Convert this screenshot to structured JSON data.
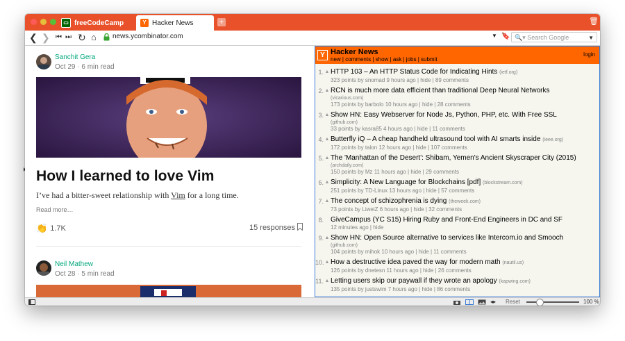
{
  "browser": {
    "tabs": [
      {
        "label": "freeCodeCamp",
        "icon": "freecodecamp-icon",
        "active": false
      },
      {
        "label": "Hacker News",
        "icon": "y-icon",
        "active": true
      }
    ],
    "url": "news.ycombinator.com",
    "search_placeholder": "Search Google",
    "tab_bar_color": "#e8512a",
    "status": {
      "reset_label": "Reset",
      "zoom_label": "100 %"
    }
  },
  "medium": {
    "posts": [
      {
        "author": "Sanchit Gera",
        "date": "Oct 29",
        "read_time": "6 min read",
        "title": "How I learned to love Vim",
        "subtitle_before": "I’ve had a bitter-sweet relationship with ",
        "subtitle_link": "Vim",
        "subtitle_after": " for a long time.",
        "read_more": "Read more…",
        "claps": "1.7K",
        "responses": "15 responses"
      },
      {
        "author": "Neil Mathew",
        "date": "Oct 28",
        "read_time": "5 min read"
      }
    ]
  },
  "hn": {
    "title": "Hacker News",
    "nav": "new | comments | show | ask | jobs | submit",
    "login": "login",
    "header_color": "#ff6600",
    "items": [
      {
        "rank": "1.",
        "title": "HTTP 103 – An HTTP Status Code for Indicating Hints",
        "site": "(ietf.org)",
        "meta": "323 points by snomad 9 hours ago | hide | 89 comments",
        "vote": true
      },
      {
        "rank": "2.",
        "title": "RCN is much more data efficient than traditional Deep Neural Networks",
        "site": "(vicarious.com)",
        "meta": "173 points by barbolo 10 hours ago | hide | 28 comments",
        "vote": true,
        "site_newline": true
      },
      {
        "rank": "3.",
        "title": "Show HN: Easy Webserver for Node Js, Python, PHP, etc. With Free SSL",
        "site": "(github.com)",
        "meta": "33 points by kasra85 4 hours ago | hide | 11 comments",
        "vote": true,
        "site_newline": true
      },
      {
        "rank": "4.",
        "title": "Butterfly iQ – A cheap handheld ultrasound tool with AI smarts inside",
        "site": "(ieee.org)",
        "meta": "172 points by taion 12 hours ago | hide | 107 comments",
        "vote": true
      },
      {
        "rank": "5.",
        "title": "The 'Manhattan of the Desert': Shibam, Yemen's Ancient Skyscraper City (2015)",
        "site": "(archdaily.com)",
        "meta": "150 points by Mz 11 hours ago | hide | 29 comments",
        "vote": true,
        "site_newline": true
      },
      {
        "rank": "6.",
        "title": "Simplicity: A New Language for Blockchains [pdf]",
        "site": "(blockstream.com)",
        "meta": "251 points by TD-Linux 13 hours ago | hide | 57 comments",
        "vote": true
      },
      {
        "rank": "7.",
        "title": "The concept of schizophrenia is dying",
        "site": "(theweek.com)",
        "meta": "73 points by LiweiZ 6 hours ago | hide | 32 comments",
        "vote": true
      },
      {
        "rank": "8.",
        "title": "GiveCampus (YC S15) Hiring Ruby and Front-End Engineers in DC and SF",
        "site": "",
        "meta": "12 minutes ago | hide",
        "vote": false
      },
      {
        "rank": "9.",
        "title": "Show HN: Open Source alternative to services like Intercom.io and Smooch",
        "site": "(github.com)",
        "meta": "104 points by mihok 10 hours ago | hide | 11 comments",
        "vote": true,
        "site_newline": true
      },
      {
        "rank": "10.",
        "title": "How a destructive idea paved the way for modern math",
        "site": "(nautil.us)",
        "meta": "126 points by dnetesn 11 hours ago | hide | 26 comments",
        "vote": true
      },
      {
        "rank": "11.",
        "title": "Letting users skip our paywall if they wrote an apology",
        "site": "(kapwing.com)",
        "meta": "135 points by justswim 7 hours ago | hide | 86 comments",
        "vote": true
      }
    ]
  }
}
